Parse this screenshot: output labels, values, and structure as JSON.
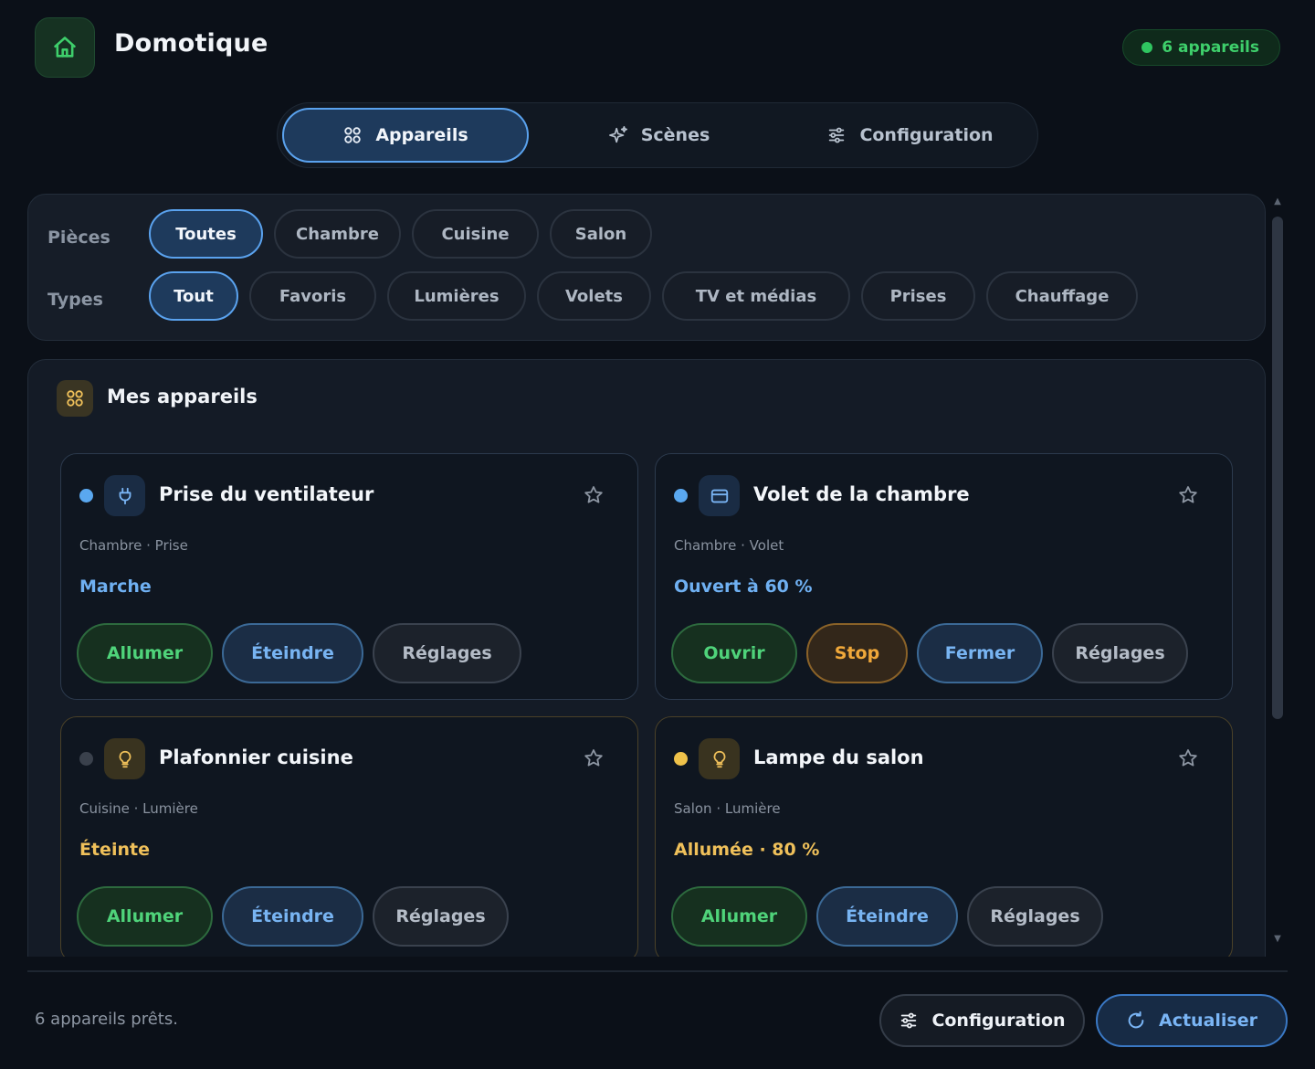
{
  "app": {
    "title": "Domotique",
    "device_count_label": "6 appareils"
  },
  "tabs": [
    {
      "label": "Appareils",
      "icon": "grid-icon",
      "active": true
    },
    {
      "label": "Scènes",
      "icon": "sparkle-icon",
      "active": false
    },
    {
      "label": "Configuration",
      "icon": "sliders-icon",
      "active": false
    }
  ],
  "filters": {
    "rooms_label": "Pièces",
    "rooms": [
      "Toutes",
      "Chambre",
      "Cuisine",
      "Salon"
    ],
    "rooms_selected": "Toutes",
    "types_label": "Types",
    "types": [
      "Tout",
      "Favoris",
      "Lumières",
      "Volets",
      "TV et médias",
      "Prises",
      "Chauffage"
    ],
    "types_selected": "Tout"
  },
  "devices": {
    "title": "Mes appareils",
    "items": [
      {
        "name": "Prise du ventilateur",
        "meta": "Chambre · Prise",
        "state": "Marche",
        "icon": "plug-icon",
        "status_color": "#5aa8f0",
        "state_color": "#6fb0f2",
        "actions": [
          "Allumer",
          "Éteindre",
          "Réglages"
        ]
      },
      {
        "name": "Volet de la chambre",
        "meta": "Chambre · Volet",
        "state": "Ouvert à 60 %",
        "icon": "shutter-icon",
        "status_color": "#5aa8f0",
        "state_color": "#6fb0f2",
        "actions": [
          "Ouvrir",
          "Stop",
          "Fermer",
          "Réglages"
        ]
      },
      {
        "name": "Plafonnier cuisine",
        "meta": "Cuisine · Lumière",
        "state": "Éteinte",
        "icon": "bulb-icon",
        "status_color": "#3a414c",
        "state_color": "#efc05a",
        "actions": [
          "Allumer",
          "Éteindre",
          "Réglages"
        ]
      },
      {
        "name": "Lampe du salon",
        "meta": "Salon · Lumière",
        "state": "Allumée · 80 %",
        "icon": "bulb-icon",
        "status_color": "#efc24a",
        "state_color": "#efc05a",
        "actions": [
          "Allumer",
          "Éteindre",
          "Réglages"
        ]
      }
    ]
  },
  "footer": {
    "status": "6 appareils prêts.",
    "config_label": "Configuration",
    "refresh_label": "Actualiser"
  },
  "colors": {
    "accent": "#5aa2ee",
    "success": "#2fc560",
    "warning": "#f0a83a"
  }
}
